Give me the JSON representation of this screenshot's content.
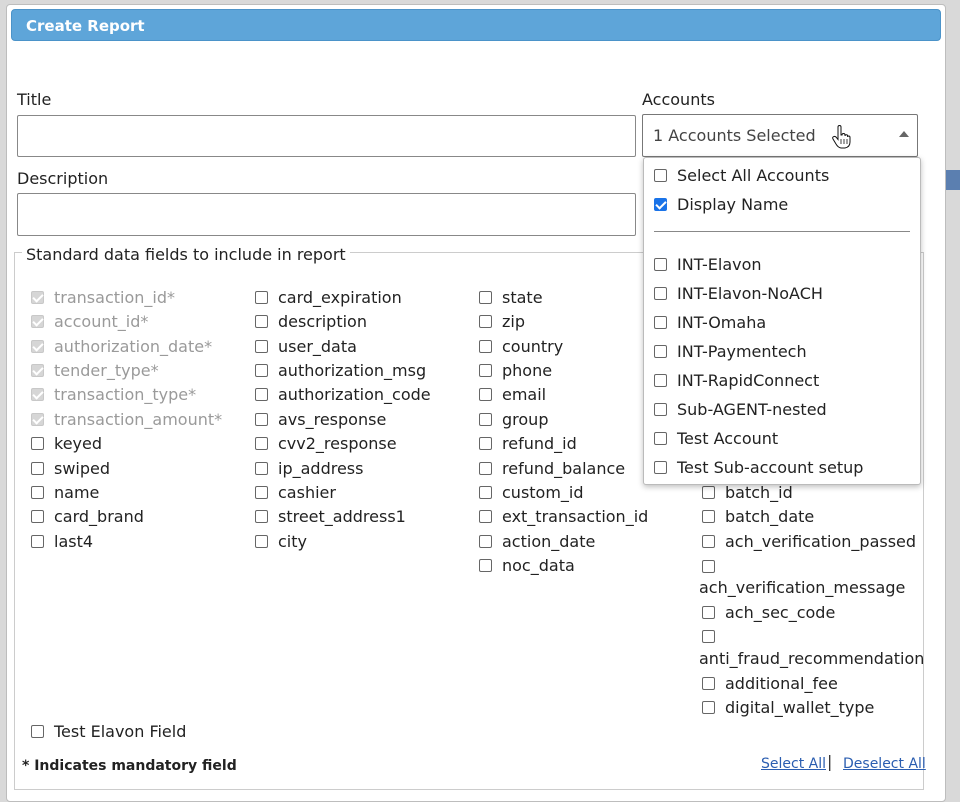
{
  "dialog": {
    "title": "Create Report"
  },
  "form": {
    "title_label": "Title",
    "title_value": "",
    "description_label": "Description",
    "description_value": "",
    "accounts_label": "Accounts",
    "accounts_selected": "1 Accounts Selected"
  },
  "accounts_dropdown": {
    "select_all": "Select All Accounts",
    "display_name": "Display Name",
    "items": [
      "INT-Elavon",
      "INT-Elavon-NoACH",
      "INT-Omaha",
      "INT-Paymentech",
      "INT-RapidConnect",
      "Sub-AGENT-nested",
      "Test Account",
      "Test Sub-account setup"
    ]
  },
  "fields": {
    "legend": "Standard data fields to include in report",
    "col1": [
      "transaction_id*",
      "account_id*",
      "authorization_date*",
      "tender_type*",
      "transaction_type*",
      "transaction_amount*",
      "keyed",
      "swiped",
      "name",
      "card_brand",
      "last4"
    ],
    "col2": [
      "card_expiration",
      "description",
      "user_data",
      "authorization_msg",
      "authorization_code",
      "avs_response",
      "cvv2_response",
      "ip_address",
      "cashier",
      "street_address1",
      "city"
    ],
    "col3": [
      "state",
      "zip",
      "country",
      "phone",
      "email",
      "group",
      "refund_id",
      "refund_balance",
      "custom_id",
      "ext_transaction_id",
      "action_date",
      "noc_data"
    ],
    "col4": [
      "batch_id",
      "batch_date",
      "ach_verification_passed",
      "ach_verification_message",
      "ach_sec_code",
      "anti_fraud_recommendation",
      "additional_fee",
      "digital_wallet_type"
    ],
    "extra": "Test Elavon Field"
  },
  "footer": {
    "mandatory_note": "* Indicates mandatory field",
    "select_all": "Select All",
    "deselect_all": "Deselect All",
    "separator": "|"
  }
}
